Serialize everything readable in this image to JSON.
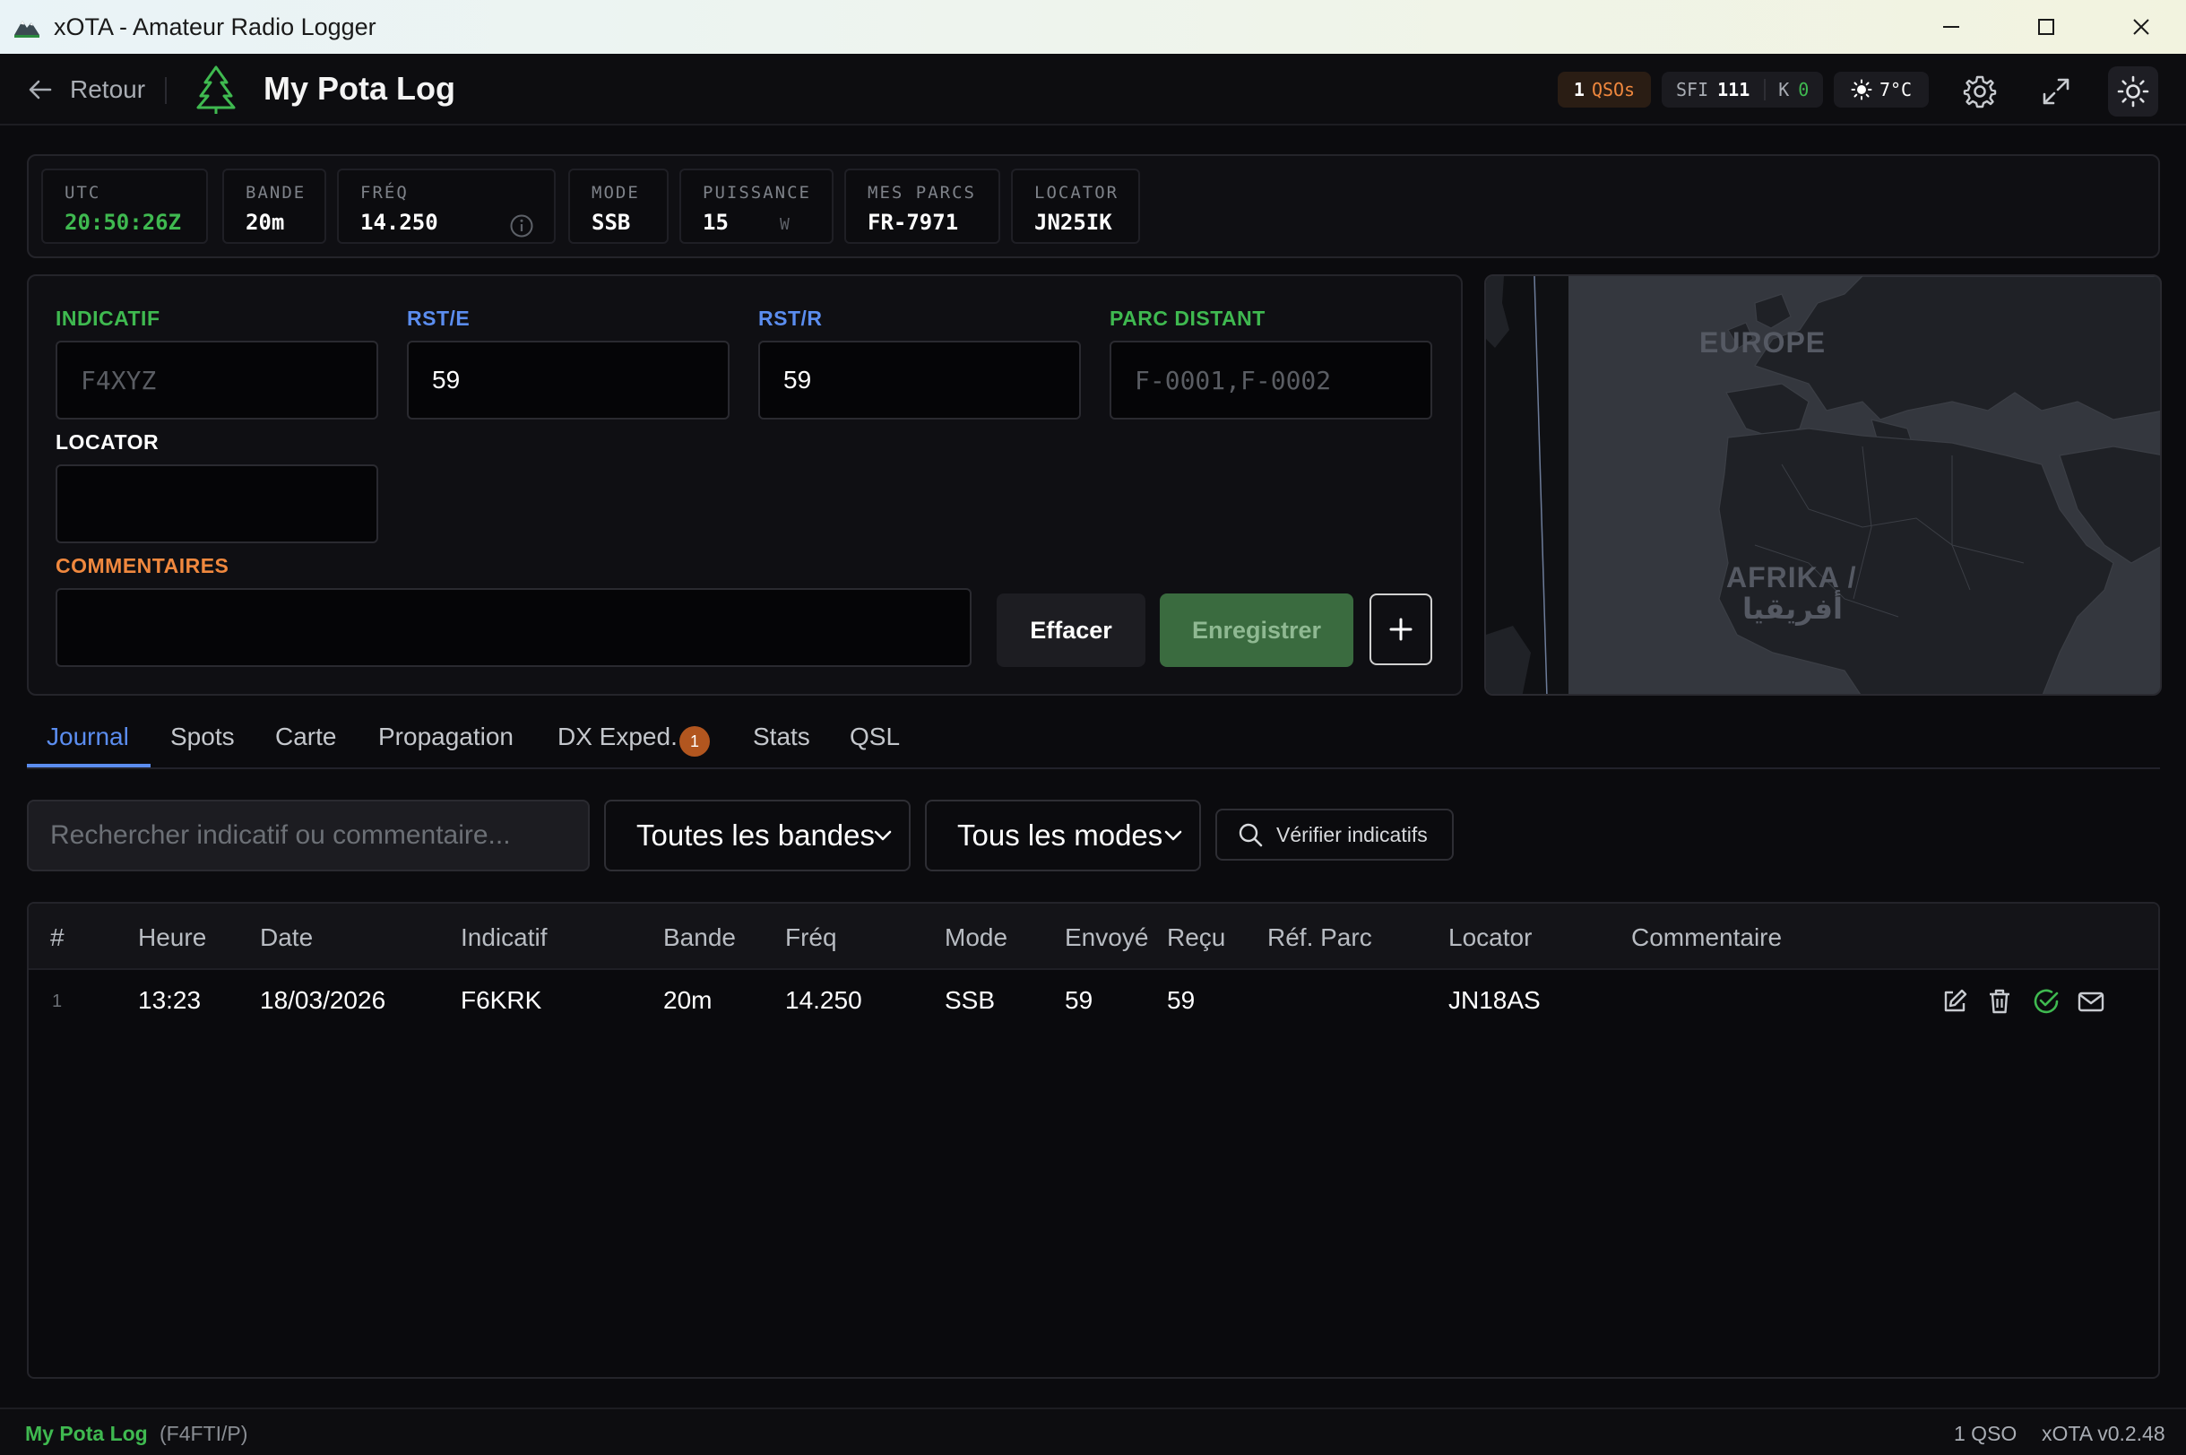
{
  "window": {
    "title": "xOTA - Amateur Radio Logger"
  },
  "header": {
    "back_label": "Retour",
    "log_title": "My Pota Log",
    "qso_count": "1",
    "qso_unit": "QSOs",
    "sfi_label": "SFI",
    "sfi_value": "111",
    "k_label": "K",
    "k_value": "0",
    "temperature": "7°C"
  },
  "status": {
    "utc_label": "UTC",
    "utc_value": "20:50:26Z",
    "band_label": "BANDE",
    "band_value": "20m",
    "freq_label": "FRÉQ",
    "freq_value": "14.250",
    "mode_label": "MODE",
    "mode_value": "SSB",
    "power_label": "PUISSANCE",
    "power_value": "15",
    "power_unit": "W",
    "parks_label": "MES PARCS",
    "parks_value": "FR-7971",
    "locator_label": "LOCATOR",
    "locator_value": "JN25IK"
  },
  "form": {
    "callsign_label": "INDICATIF",
    "callsign_placeholder": "F4XYZ",
    "rst_sent_label": "RST/E",
    "rst_sent_value": "59",
    "rst_rcvd_label": "RST/R",
    "rst_rcvd_value": "59",
    "remote_park_label": "PARC DISTANT",
    "remote_park_placeholder": "F-0001,F-0002",
    "locator_label": "LOCATOR",
    "locator_value": "",
    "comments_label": "COMMENTAIRES",
    "comments_value": "",
    "clear_button": "Effacer",
    "save_button": "Enregistrer"
  },
  "map": {
    "label_europe": "EUROPE",
    "label_africa_1": "AFRIKA /",
    "label_africa_2": "أفريقيا"
  },
  "tabs": [
    {
      "label": "Journal",
      "active": true
    },
    {
      "label": "Spots"
    },
    {
      "label": "Carte"
    },
    {
      "label": "Propagation"
    },
    {
      "label": "DX Exped.",
      "badge": "1"
    },
    {
      "label": "Stats"
    },
    {
      "label": "QSL"
    }
  ],
  "filters": {
    "search_placeholder": "Rechercher indicatif ou commentaire...",
    "band_select": "Toutes les bandes",
    "mode_select": "Tous les modes",
    "verify_button": "Vérifier indicatifs"
  },
  "table": {
    "columns": [
      "#",
      "Heure",
      "Date",
      "Indicatif",
      "Bande",
      "Fréq",
      "Mode",
      "Envoyé",
      "Reçu",
      "Réf. Parc",
      "Locator",
      "Commentaire"
    ],
    "rows": [
      {
        "num": "1",
        "time": "13:23",
        "date": "18/03/2026",
        "callsign": "F6KRK",
        "band": "20m",
        "freq": "14.250",
        "mode": "SSB",
        "sent": "59",
        "rcvd": "59",
        "park": "",
        "locator": "JN18AS",
        "comment": ""
      }
    ]
  },
  "footer": {
    "log_name": "My Pota Log",
    "callsign": "(F4FTI/P)",
    "qso_count": "1 QSO",
    "version": "xOTA v0.2.48"
  },
  "colors": {
    "accent_blue": "#5b8def",
    "accent_green": "#3fb950",
    "accent_orange": "#f0883e",
    "save_green": "#3a6b3f"
  }
}
